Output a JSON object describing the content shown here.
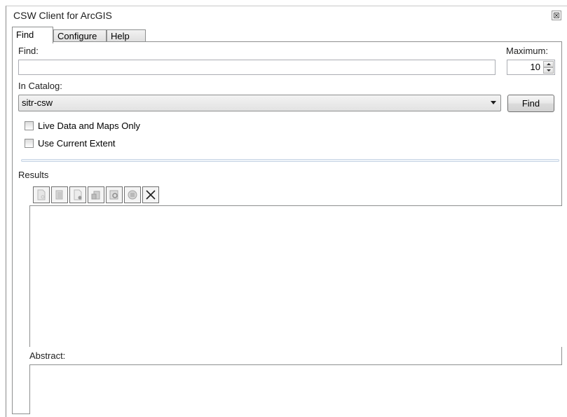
{
  "window": {
    "title": "CSW Client for ArcGIS"
  },
  "tabs": [
    {
      "label": "Find",
      "active": true
    },
    {
      "label": "Configure",
      "active": false
    },
    {
      "label": "Help",
      "active": false
    }
  ],
  "find_tab": {
    "find_label": "Find:",
    "find_value": "",
    "maximum_label": "Maximum:",
    "maximum_value": "10",
    "catalog_label": "In Catalog:",
    "catalog_selected": "sitr-csw",
    "find_button": "Find",
    "live_data_label": "Live Data and Maps Only",
    "live_data_checked": false,
    "current_extent_label": "Use Current Extent",
    "current_extent_checked": false,
    "results_label": "Results",
    "abstract_label": "Abstract:"
  },
  "results_toolbar": [
    {
      "icon": "view-metadata-icon",
      "enabled": false
    },
    {
      "icon": "zoom-to-icon",
      "enabled": false
    },
    {
      "icon": "add-to-map-icon",
      "enabled": false
    },
    {
      "icon": "download-icon",
      "enabled": false
    },
    {
      "icon": "view-details-icon",
      "enabled": false
    },
    {
      "icon": "save-icon",
      "enabled": false
    },
    {
      "icon": "clear-results-icon",
      "enabled": true
    }
  ]
}
